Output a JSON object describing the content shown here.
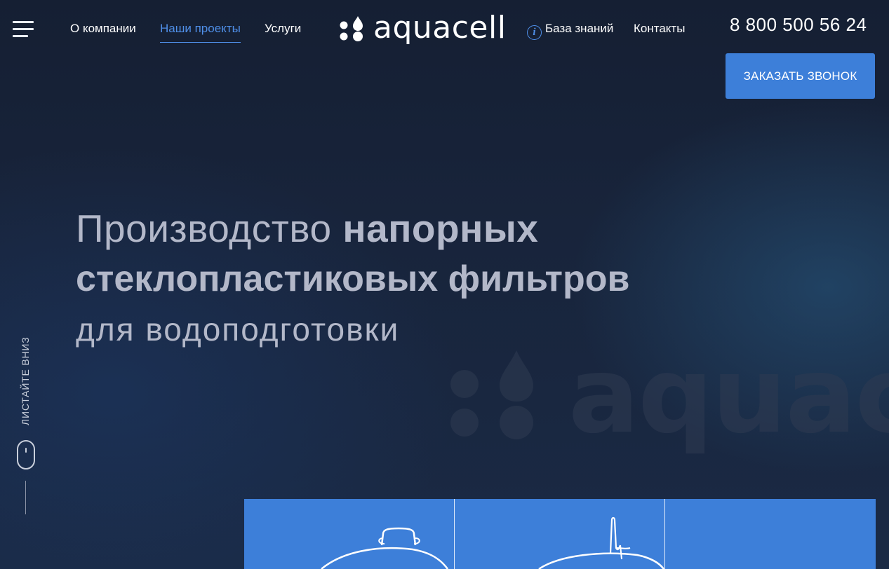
{
  "header": {
    "menu_icon": "hamburger-menu-icon",
    "nav": [
      {
        "label": "О компании"
      },
      {
        "label": "Наши проекты",
        "active": true
      },
      {
        "label": "Услуги"
      }
    ],
    "logo": {
      "text": "aquacell",
      "icon": "droplets-logo-icon"
    },
    "knowledge_base": {
      "label": "База знаний",
      "icon": "info-icon"
    },
    "contacts": {
      "label": "Контакты"
    },
    "phone": "8 800 500 56 24",
    "callback_button": "ЗАКАЗАТЬ ЗВОНОК"
  },
  "hero": {
    "line1_light": "Производство ",
    "line1_bold": "напорных",
    "line2": "стеклопластиковых фильтров",
    "line3": "для водоподготовки"
  },
  "watermark_text": "aquac",
  "scroll_hint": {
    "label": "ЛИСТАЙТЕ ВНИЗ",
    "icon": "mouse-scroll-icon"
  },
  "colors": {
    "background": "#172238",
    "accent": "#3d7fd9",
    "active_link": "#4f8fe8",
    "hero_text": "#b3b8c9"
  }
}
